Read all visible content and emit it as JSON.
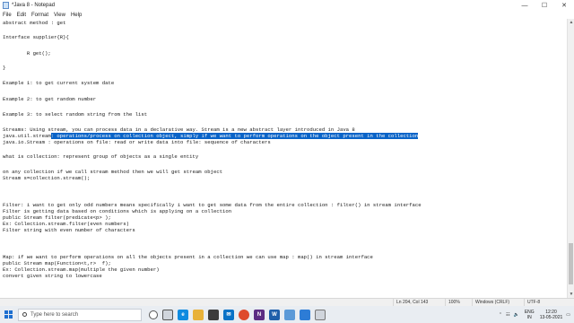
{
  "window": {
    "title": "*Java 8 - Notepad",
    "minimize_glyph": "—",
    "maximize_glyph": "☐",
    "close_glyph": "✕"
  },
  "menu": [
    "File",
    "Edit",
    "Format",
    "View",
    "Help"
  ],
  "editor": {
    "lines": [
      "abstract method : get",
      "Interface supplier{R}{",
      "        R get();",
      "}",
      "Example 1: to get current system date",
      "Example 2: to get random number",
      "Example 3: to select random string from the list",
      "Streams: Using stream, you can process data in a declarative way. Stream is a new abstract layer introduced in Java 8",
      "java.io.Stream : operations on file: read or write data into file: sequence of characters",
      "what is collection: represent group of objects as a single entity",
      "on any collection if we call stream method then we will get stream object",
      "Stream s=collection.stream();",
      "Filter: i want to get only odd numbers means specifically i want to get some data from the entire collection : filter() in stream interface",
      "Filter is getting data based on conditions which is applying on a collection",
      "public Stream filter(predicate<p> );",
      "Ex: Collection.stream.filter(even numbers)",
      "Filter string with even number of characters",
      "Map: if we want to perform operations on all the objects present in a collection we can use map : map() in stream interface",
      "public Stream map(Function<t,r>  f);",
      "Ex: Collection.stream.map(multiple the given number)",
      "convert given string to lowercase"
    ],
    "selected_line": {
      "prefix": "java.util.stream",
      "selection": ": operations/process on collection object, simply if we want to perform operations on the object present in the collection"
    }
  },
  "statusbar": {
    "position": "Ln 204, Col 143",
    "zoom": "100%",
    "line_ending": "Windows (CRLF)",
    "encoding": "UTF-8"
  },
  "taskbar": {
    "search_placeholder": "Type here to search",
    "lang": "ENG",
    "region": "IN",
    "time": "12:20",
    "date": "13-05-2021"
  }
}
